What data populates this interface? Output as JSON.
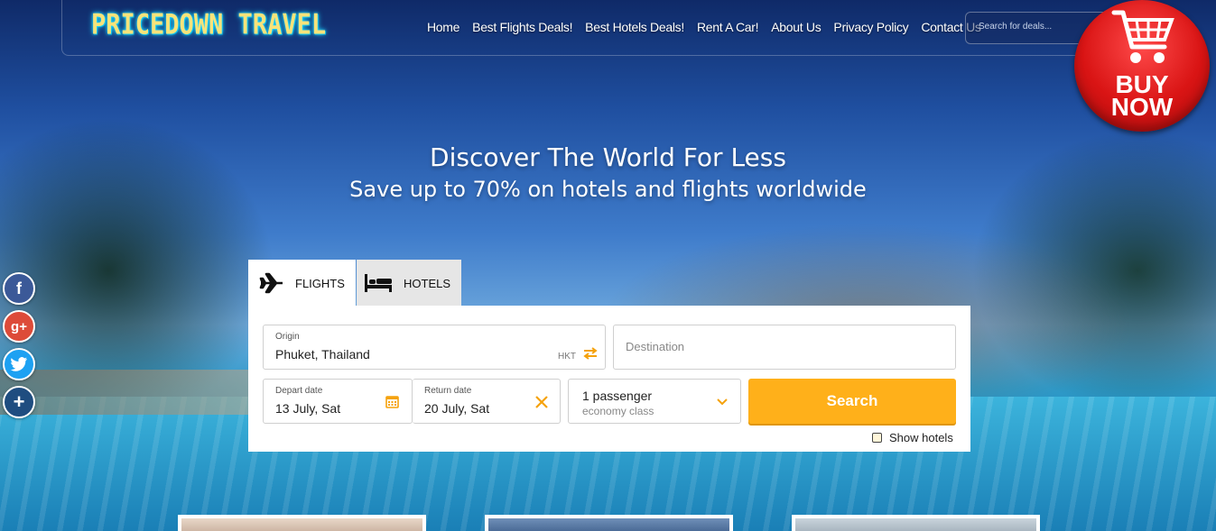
{
  "header": {
    "logo": "PRICEDOWN TRAVEL",
    "nav": [
      "Home",
      "Best Flights Deals!",
      "Best Hotels Deals!",
      "Rent A Car!",
      "About Us",
      "Privacy Policy",
      "Contact Us"
    ],
    "search_placeholder": "Search for deals..."
  },
  "buy_now": {
    "line1": "BUY",
    "line2": "NOW",
    "icon": "shopping-cart-icon"
  },
  "hero": {
    "title": "Discover The World For Less",
    "subtitle": "Save up to 70% on hotels and flights worldwide"
  },
  "social": [
    {
      "icon": "facebook-icon",
      "glyph": "f",
      "color": "#3b5998"
    },
    {
      "icon": "google-plus-icon",
      "glyph": "g+",
      "color": "#dd4b39"
    },
    {
      "icon": "twitter-icon",
      "glyph": "t",
      "color": "#1da1f2"
    },
    {
      "icon": "plus-icon",
      "glyph": "+",
      "color": "#1f4d80"
    }
  ],
  "search_form": {
    "tabs": {
      "flights": "FLIGHTS",
      "hotels": "HOTELS"
    },
    "origin": {
      "label": "Origin",
      "value": "Phuket, Thailand",
      "code": "HKT"
    },
    "destination": {
      "placeholder": "Destination"
    },
    "depart": {
      "label": "Depart date",
      "value": "13 July, Sat"
    },
    "return": {
      "label": "Return date",
      "value": "20 July, Sat"
    },
    "passengers": {
      "count": "1 passenger",
      "class": "economy class"
    },
    "search_label": "Search",
    "show_hotels_label": "Show hotels"
  },
  "colors": {
    "accent": "#ffb01a",
    "icon_accent": "#f5a20d"
  }
}
